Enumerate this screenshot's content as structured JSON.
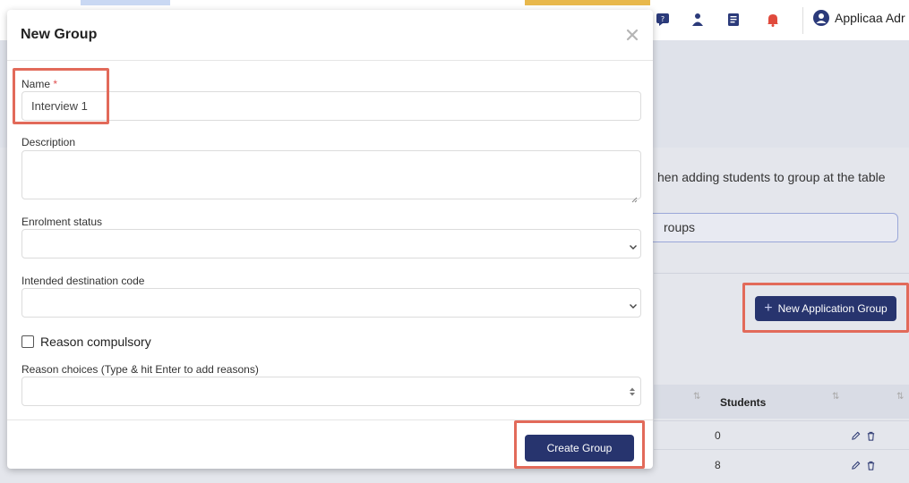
{
  "topbar": {
    "user_name": "Applicaa Adr",
    "icons": [
      "chat-icon",
      "user-upload-icon",
      "document-icon",
      "bell-icon"
    ]
  },
  "background": {
    "instruction_text": "hen adding students to group at the table",
    "search_value": "roups",
    "new_application_group_label": "New Application Group",
    "table": {
      "columns": [
        "Students"
      ],
      "rows": [
        {
          "students": "0"
        },
        {
          "students": "8"
        }
      ]
    }
  },
  "modal": {
    "title": "New Group",
    "name_label": "Name",
    "required_marker": "*",
    "name_value": "Interview 1",
    "description_label": "Description",
    "description_value": "",
    "enrolment_status_label": "Enrolment status",
    "enrolment_status_value": "",
    "intended_destination_label": "Intended destination code",
    "intended_destination_value": "",
    "reason_compulsory_label": "Reason compulsory",
    "reason_compulsory_checked": false,
    "reason_choices_label": "Reason choices (Type & hit Enter to add reasons)",
    "reason_choices_value": "",
    "create_button_label": "Create Group"
  },
  "colors": {
    "primary_button": "#27346e",
    "highlight": "#e26a5a",
    "required": "#e05050"
  }
}
